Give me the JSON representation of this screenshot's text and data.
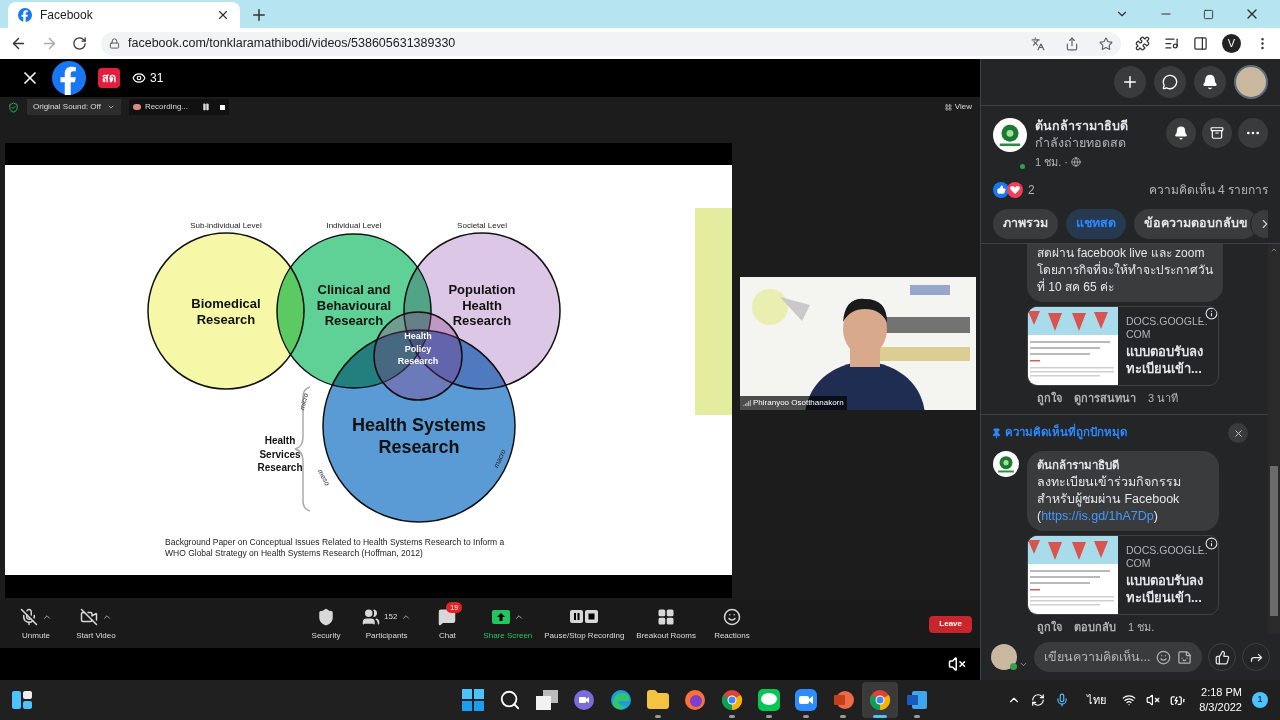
{
  "browser": {
    "tab": {
      "title": "Facebook"
    },
    "url": "facebook.com/tonklaramathibodi/videos/538605631389330",
    "profile_initial": "V"
  },
  "video": {
    "live_badge": "สด",
    "viewers": "31",
    "zoom_bar": {
      "sound": "Original Sound: Off",
      "recording": "Recording...",
      "view": "View"
    },
    "slide": {
      "levels": [
        "Sub-individual Level",
        "Individual Level",
        "Societal Level"
      ],
      "circles": [
        {
          "label": "Biomedical Research",
          "color": "#f7f7a8"
        },
        {
          "label": "Clinical and Behavioural Research",
          "color": "#5fd196"
        },
        {
          "label": "Population Health Research",
          "color": "#dcc8e6"
        },
        {
          "label": "Health Systems Research",
          "color": "#5b9bd5"
        }
      ],
      "center_label": "Health Policy Research",
      "side_label": "Health Services Research",
      "scale_labels": [
        "micro",
        "meso",
        "macro"
      ],
      "caption": "Background Paper on Conceptual Issues Related to Health Systems Research to Inform a WHO Global Strategy on Health Systems Research (Hoffman, 2012)"
    },
    "speaker": {
      "name": "Phiranyoo Osotthanakorn"
    },
    "toolbar": {
      "left": [
        {
          "label": "Unmute",
          "kind": "mic",
          "caret": true
        },
        {
          "label": "Start Video",
          "kind": "video",
          "caret": true
        }
      ],
      "center": [
        {
          "label": "Security",
          "kind": "security",
          "caret": false
        },
        {
          "label": "Participants",
          "kind": "participants",
          "count": "152",
          "caret": true
        },
        {
          "label": "Chat",
          "kind": "chat",
          "badge": "19",
          "caret": false
        },
        {
          "label": "Share Screen",
          "kind": "share",
          "caret": true
        },
        {
          "label": "Pause/Stop Recording",
          "kind": "recording",
          "caret": false
        },
        {
          "label": "Breakout Rooms",
          "kind": "rooms",
          "caret": false
        },
        {
          "label": "Reactions",
          "kind": "reactions",
          "caret": false
        }
      ]
    },
    "leave": "Leave"
  },
  "panel": {
    "page": {
      "name": "ต้นกล้ารามาธิบดี",
      "status": "กำลังถ่ายทอดสด",
      "time": "1 ชม. ·",
      "online": true
    },
    "reactions": {
      "count": "2",
      "comments": "ความคิดเห็น 4 รายการ"
    },
    "tabs": [
      {
        "label": "ภาพรวม",
        "selected": false
      },
      {
        "label": "แชทสด",
        "selected": true
      },
      {
        "label": "ข้อความตอบกลับข",
        "selected": false
      }
    ],
    "comment": {
      "text": "สดผ่าน facebook live และ zoom โดยภารกิจที่จะให้ทำจะประกาศวัน ที่ 10 สค 65 ค่ะ",
      "link_card": {
        "domain": "DOCS.GOOGLE.COM",
        "title": "แบบตอบรับลงทะเบียนเข้า..."
      },
      "actions": [
        "ถูกใจ",
        "ดูการสนทนา"
      ],
      "time": "3 นาที"
    },
    "pinned": {
      "label": "ความคิดเห็นที่ถูกปักหมุด",
      "author": "ต้นกล้ารามาธิบดี",
      "text_before": "ลงทะเบียนเข้าร่วมกิจกรรมสำหรับผู้ชมผ่าน Facebook (",
      "link": "https://is.gd/1hA7Dp",
      "text_after": ")",
      "link_card": {
        "domain": "DOCS.GOOGLE.COM",
        "title": "แบบตอบรับลงทะเบียนเข้า..."
      },
      "actions": [
        "ถูกใจ",
        "ตอบกลับ"
      ],
      "time": "1 ชม."
    },
    "composer": {
      "placeholder": "เขียนความคิดเห็น..."
    }
  },
  "taskbar": {
    "apps": [
      {
        "kind": "windows",
        "running": false,
        "active": false
      },
      {
        "kind": "search",
        "running": false,
        "active": false
      },
      {
        "kind": "taskview",
        "running": false,
        "active": false
      },
      {
        "kind": "teams",
        "running": false,
        "active": false
      },
      {
        "kind": "edge",
        "running": false,
        "active": false
      },
      {
        "kind": "explorer",
        "running": true,
        "active": false
      },
      {
        "kind": "firefox",
        "running": false,
        "active": false
      },
      {
        "kind": "chrome",
        "running": true,
        "active": false
      },
      {
        "kind": "line",
        "running": true,
        "active": false
      },
      {
        "kind": "zoom",
        "running": true,
        "active": false
      },
      {
        "kind": "powerpoint",
        "running": true,
        "active": false
      },
      {
        "kind": "chrome",
        "running": true,
        "active": true
      },
      {
        "kind": "word",
        "running": true,
        "active": false
      }
    ],
    "language": "ไทย",
    "time": "2:18 PM",
    "date": "8/3/2022",
    "notifications": "1"
  }
}
